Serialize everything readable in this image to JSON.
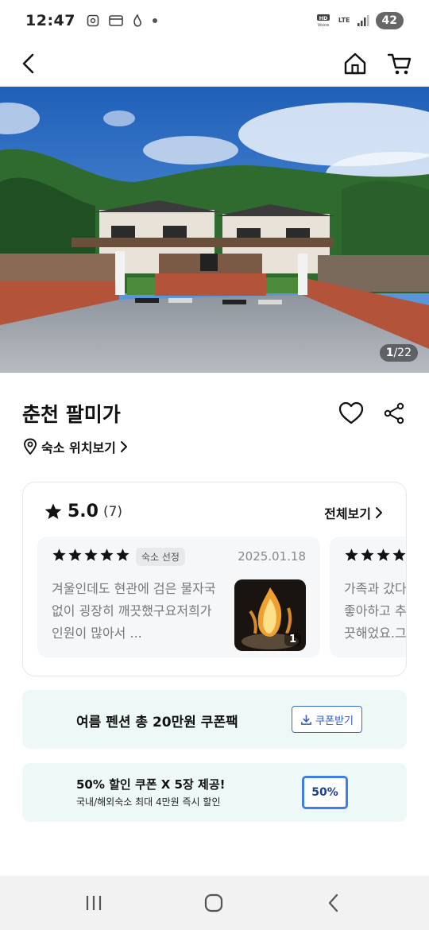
{
  "status_bar": {
    "time": "12:47",
    "hd_label": "HD\nVoice",
    "lte_label": "LTE",
    "battery": "42"
  },
  "nav": {
    "back_icon": "chevron-left-icon",
    "home_icon": "home-icon",
    "cart_icon": "cart-icon"
  },
  "hero": {
    "current": "1",
    "total": "/22"
  },
  "listing": {
    "title": "춘천 팔미가",
    "location_link": "숙소 위치보기"
  },
  "reviews": {
    "score": "5.0",
    "count": "(7)",
    "see_all": "전체보기",
    "items": [
      {
        "stars": 5,
        "badge": "숙소 선정",
        "date": "2025.01.18",
        "text": "겨울인데도 현관에 검은 물자국 없이 굉장히 깨끗했구요저희가 인원이 많아서 ...",
        "photo_count": "1"
      },
      {
        "stars": 5,
        "text": "가족과 갔다 좋아하고 추 끗해었요.그"
      }
    ]
  },
  "coupons": {
    "c1": {
      "title": "여름 펜션 총 20만원 쿠폰팩",
      "button": "쿠폰받기"
    },
    "c2": {
      "title": "50% 할인 쿠폰 X 5장 제공!",
      "subtitle": "국내/해외숙소 최대 4만원 즉시 할인",
      "tag": "50%"
    }
  },
  "colors": {
    "accent_blue": "#2e5cc8",
    "banner_bg": "#eef8f6",
    "star": "#111111"
  }
}
